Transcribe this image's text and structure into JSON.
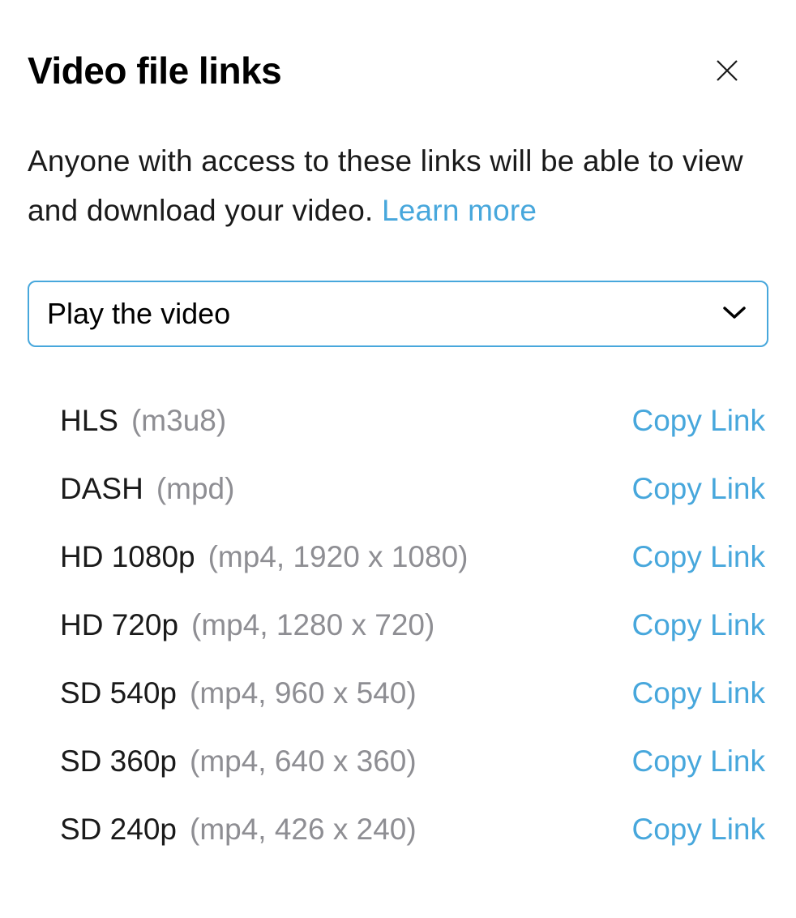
{
  "header": {
    "title": "Video file links"
  },
  "description": {
    "text": "Anyone with access to these links will be able to view and download your video.  ",
    "learn_more_label": "Learn more"
  },
  "dropdown": {
    "selected": "Play the video"
  },
  "copy_link_label": "Copy Link",
  "formats": [
    {
      "name": "HLS",
      "detail": "(m3u8)"
    },
    {
      "name": "DASH",
      "detail": "(mpd)"
    },
    {
      "name": "HD 1080p",
      "detail": "(mp4, 1920 x 1080)"
    },
    {
      "name": "HD 720p",
      "detail": "(mp4, 1280 x 720)"
    },
    {
      "name": "SD 540p",
      "detail": "(mp4, 960 x 540)"
    },
    {
      "name": "SD 360p",
      "detail": "(mp4, 640 x 360)"
    },
    {
      "name": "SD 240p",
      "detail": "(mp4, 426 x 240)"
    }
  ]
}
